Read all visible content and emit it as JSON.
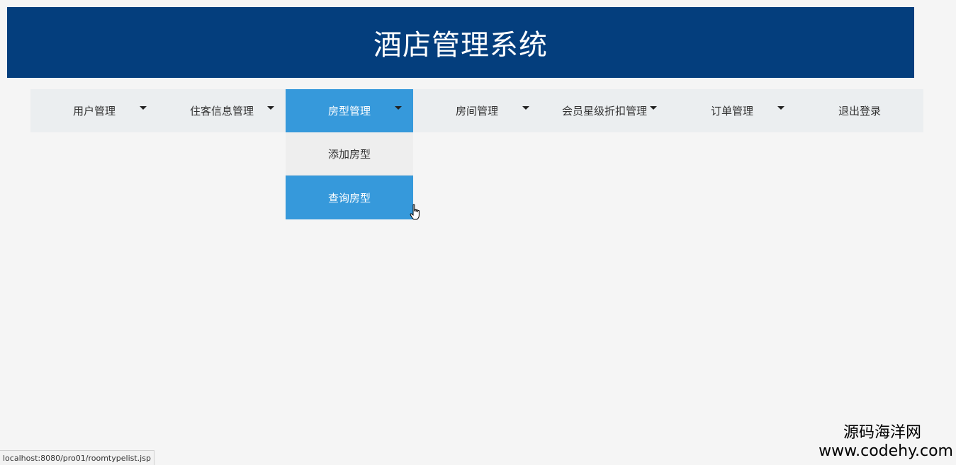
{
  "header": {
    "title": "酒店管理系统"
  },
  "nav": {
    "items": [
      {
        "label": "用户管理",
        "has_dropdown": true
      },
      {
        "label": "住客信息管理",
        "has_dropdown": true
      },
      {
        "label": "房型管理",
        "has_dropdown": true,
        "active": true
      },
      {
        "label": "房间管理",
        "has_dropdown": true
      },
      {
        "label": "会员星级折扣管理",
        "has_dropdown": true
      },
      {
        "label": "订单管理",
        "has_dropdown": true
      },
      {
        "label": "退出登录",
        "has_dropdown": false
      }
    ]
  },
  "dropdown": {
    "items": [
      {
        "label": "添加房型"
      },
      {
        "label": "查询房型",
        "hovered": true
      }
    ]
  },
  "status_bar": {
    "url": "localhost:8080/pro01/roomtypelist.jsp"
  },
  "watermark": {
    "line1": "源码海洋网",
    "line2": "www.codehy.com"
  },
  "colors": {
    "header_bg": "#043e7d",
    "nav_bg": "#ebeef0",
    "accent": "#3699db",
    "page_bg": "#f5f5f5"
  },
  "icons": {
    "cursor": "hand-pointer-icon",
    "caret": "caret-down-icon"
  }
}
